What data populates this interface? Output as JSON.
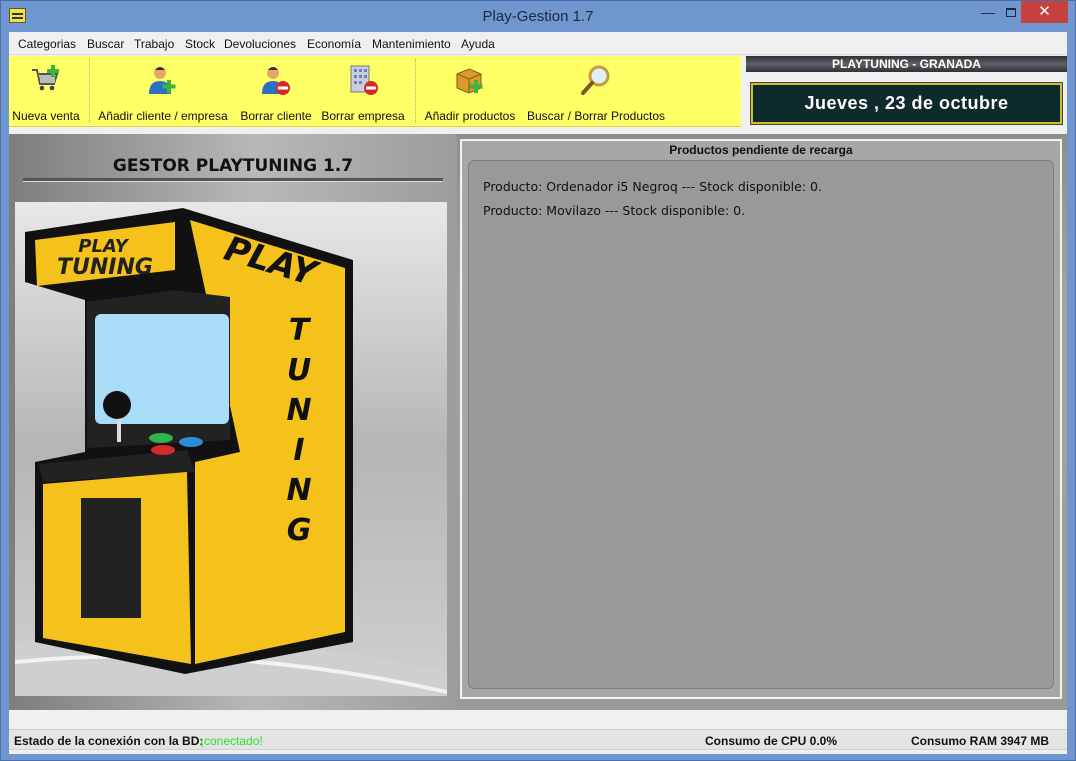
{
  "window": {
    "title": "Play-Gestion 1.7",
    "minimize": "—",
    "close": "✕"
  },
  "menu": [
    "Categorias",
    "Buscar",
    "Trabajo",
    "Stock",
    "Devoluciones",
    "Economía",
    "Mantenimiento",
    "Ayuda"
  ],
  "toolbar": {
    "new_sale": "Nueva venta",
    "add_client": "Añadir cliente / empresa",
    "delete_client": "Borrar cliente",
    "delete_company": "Borrar empresa",
    "add_products": "Añadir productos",
    "search_products": "Buscar / Borrar Productos"
  },
  "header": {
    "store": "PLAYTUNING - GRANADA",
    "date": "Jueves ,  23  de  octubre"
  },
  "left": {
    "title": "GESTOR PLAYTUNING 1.7",
    "logo_text_a": "PLAY",
    "logo_text_b": "TUNING"
  },
  "pending": {
    "title": "Productos pendiente de recarga",
    "items": [
      "Producto: Ordenador i5 Negroq --- Stock disponible: 0.",
      "Producto: Movilazo --- Stock disponible: 0."
    ]
  },
  "status": {
    "db_label": "Estado de la conexión con la BD:",
    "db_value": "¡conectado!",
    "cpu": "Consumo de CPU  0.0%",
    "ram": "Consumo RAM 3947 MB"
  },
  "colors": {
    "toolbar": "#ffff66",
    "arcade_yellow": "#f5c21b",
    "status_ok": "#2ee02e"
  }
}
